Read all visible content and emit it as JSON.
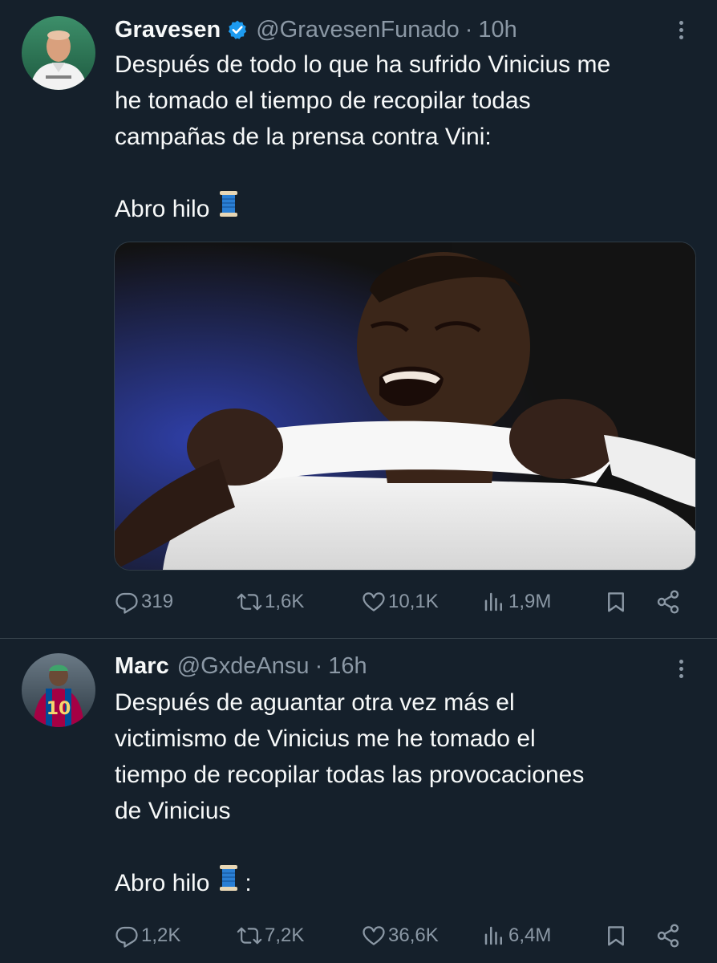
{
  "tweets": [
    {
      "name": "Gravesen",
      "verified": true,
      "handle": "@GravesenFunado",
      "separator": "·",
      "time": "10h",
      "text_lines": [
        "Después de todo lo que ha sufrido Vinicius me",
        "he tomado el tiempo de recopilar todas",
        "campañas de la prensa contra Vini:"
      ],
      "thread_label": "Abro hilo",
      "thread_suffix": "",
      "has_media": true,
      "replies": "319",
      "retweets": "1,6K",
      "likes": "10,1K",
      "views": "1,9M"
    },
    {
      "name": "Marc",
      "verified": false,
      "handle": "@GxdeAnsu",
      "separator": "·",
      "time": "16h",
      "text_lines": [
        "Después de aguantar otra vez más el",
        "victimismo de Vinicius me he tomado el",
        "tiempo de recopilar todas las provocaciones",
        "de Vinicius"
      ],
      "thread_label": "Abro hilo",
      "thread_suffix": ":",
      "has_media": false,
      "replies": "1,2K",
      "retweets": "7,2K",
      "likes": "36,6K",
      "views": "6,4M"
    }
  ],
  "colors": {
    "background": "#15202b",
    "text_primary": "#f7f9f9",
    "text_secondary": "#8b98a5",
    "verified_badge": "#1d9bf0",
    "divider": "#38444d"
  },
  "icons": {
    "reply": "reply-icon",
    "retweet": "retweet-icon",
    "like": "like-icon",
    "views": "views-icon",
    "bookmark": "bookmark-icon",
    "share": "share-icon",
    "more": "more-options-icon",
    "verified": "verified-badge-icon",
    "thread": "thread-spool-emoji"
  }
}
